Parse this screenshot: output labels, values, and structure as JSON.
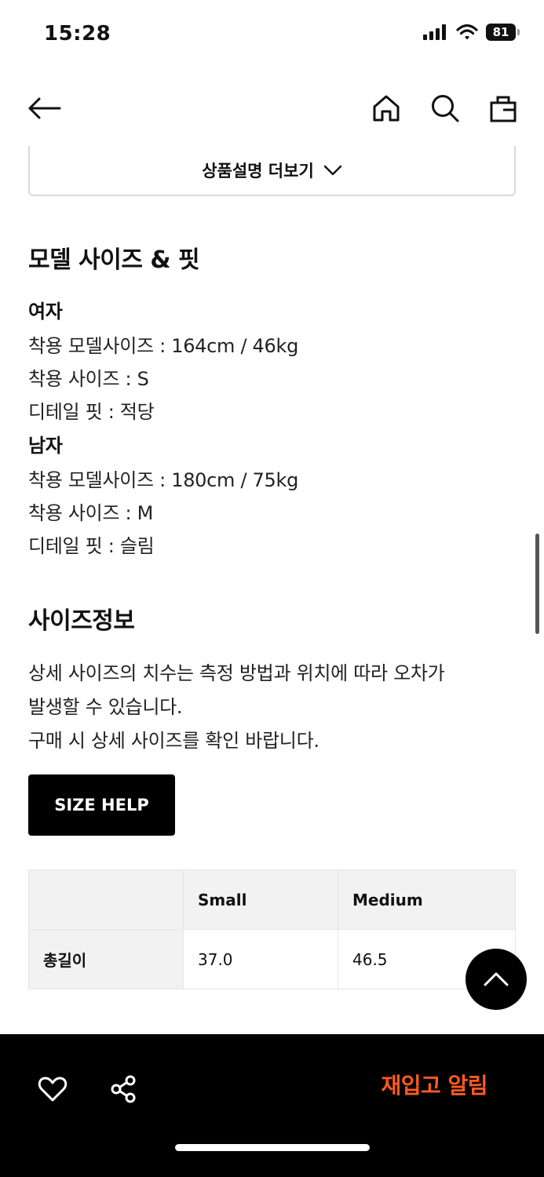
{
  "status_bar": {
    "time": "15:28",
    "battery": "81"
  },
  "description": {
    "more_label": "상품설명 더보기"
  },
  "model_fit": {
    "title": "모델 사이즈 & 핏",
    "female_label": "여자",
    "female_model_size": "착용 모델사이즈 : 164cm / 46kg",
    "female_wear_size": "착용 사이즈 : S",
    "female_fit": "디테일 핏 : 적당",
    "male_label": "남자",
    "male_model_size": "착용 모델사이즈 : 180cm / 75kg",
    "male_wear_size": "착용 사이즈 : M",
    "male_fit": "디테일 핏 : 슬림"
  },
  "size_info": {
    "title": "사이즈정보",
    "line1": "상세 사이즈의 치수는 측정 방법과 위치에 따라 오차가",
    "line2": "발생할 수 있습니다.",
    "line3": "구매 시 상세 사이즈를 확인 바랍니다.",
    "help_button": "SIZE HELP",
    "table": {
      "headers": [
        "",
        "Small",
        "Medium"
      ],
      "rows": [
        {
          "label": "총길이",
          "values": [
            "37.0",
            "46.5"
          ]
        }
      ]
    }
  },
  "bottom_bar": {
    "restock_label": "재입고 알림"
  },
  "icons": {
    "back": "arrow-left-icon",
    "home": "home-icon",
    "search": "search-icon",
    "bag": "shopping-bag-icon",
    "chevron": "chevron-down-icon",
    "scroll_top": "chevron-up-icon",
    "wishlist": "heart-icon",
    "share": "share-icon"
  },
  "colors": {
    "accent": "#ff5a1f",
    "bottom_bar": "#000000",
    "table_header": "#f2f2f2"
  }
}
